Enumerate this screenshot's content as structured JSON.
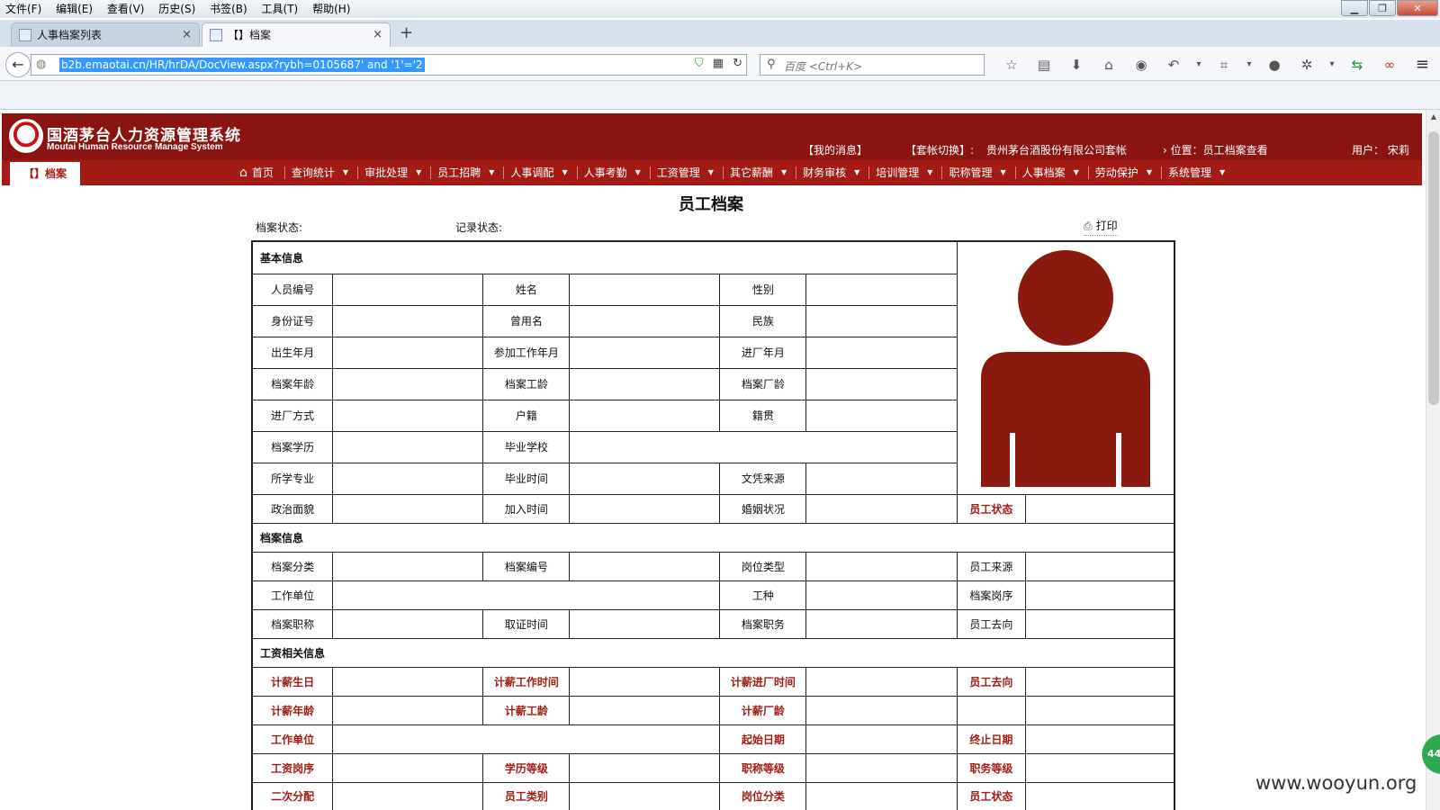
{
  "browser": {
    "menu": [
      "文件(F)",
      "编辑(E)",
      "查看(V)",
      "历史(S)",
      "书签(B)",
      "工具(T)",
      "帮助(H)"
    ],
    "window_controls": {
      "minimize": "▁",
      "restore": "❐",
      "close": "✕"
    },
    "tabs": [
      {
        "label": "人事档案列表",
        "close": "×"
      },
      {
        "label": "【】档案",
        "close": "×"
      }
    ],
    "new_tab": "+",
    "back": "←",
    "url": "b2b.emaotai.cn/HR/hrDA/DocView.aspx?rybh=0105687' and '1'='2",
    "url_icons": {
      "shield": "⛉",
      "qr": "▦",
      "reload": "↻"
    },
    "search_placeholder": "百度 <Ctrl+K>",
    "toolbar_icons": [
      {
        "name": "bookmark-star-icon",
        "glyph": "☆"
      },
      {
        "name": "reading-list-icon",
        "glyph": "▤"
      },
      {
        "name": "download-icon",
        "glyph": "⬇"
      },
      {
        "name": "home-icon",
        "glyph": "⌂"
      },
      {
        "name": "chat-icon",
        "glyph": "◉"
      },
      {
        "name": "undo-icon",
        "glyph": "↶"
      },
      {
        "name": "dropdown-icon",
        "glyph": "▾"
      },
      {
        "name": "crop-icon",
        "glyph": "⌗"
      },
      {
        "name": "dropdown-icon",
        "glyph": "▾"
      },
      {
        "name": "message-icon",
        "glyph": "●"
      },
      {
        "name": "bug-icon",
        "glyph": "✲"
      },
      {
        "name": "dropdown-icon",
        "glyph": "▾"
      },
      {
        "name": "sync-icon",
        "glyph": "⇆"
      },
      {
        "name": "link-icon",
        "glyph": "∞"
      }
    ],
    "menu_icon": "≡"
  },
  "app": {
    "logo_title": "国酒茅台人力资源管理系统",
    "logo_subtitle": "Moutai Human Resource Manage System",
    "my_messages": "【我的消息】",
    "account_switch": "【套帐切换】:",
    "account_value": "贵州茅台酒股份有限公司套帐",
    "location": "› 位置：员工档案查看",
    "user": "用户：  宋莉",
    "active_tab": "【】档案",
    "nav": [
      "首页",
      "查询统计",
      "审批处理",
      "员工招聘",
      "人事调配",
      "人事考勤",
      "工资管理",
      "其它薪酬",
      "财务审核",
      "培训管理",
      "职称管理",
      "人事档案",
      "劳动保护",
      "系统管理"
    ],
    "nav_caret": "▼",
    "home_glyph": "⌂",
    "page_title": "员工档案",
    "doc_status_label": "档案状态:",
    "record_status_label": "记录状态:",
    "print_label": "打印",
    "print_glyph": "⎙"
  },
  "table": {
    "section_basic": "基本信息",
    "section_archive": "档案信息",
    "section_salary": "工资相关信息",
    "basic_rows": [
      [
        "人员编号",
        "姓名",
        "性别"
      ],
      [
        "身份证号",
        "曾用名",
        "民族"
      ],
      [
        "出生年月",
        "参加工作年月",
        "进厂年月"
      ],
      [
        "档案年龄",
        "档案工龄",
        "档案厂龄"
      ],
      [
        "进厂方式",
        "户籍",
        "籍贯"
      ]
    ],
    "edu_row": [
      "档案学历",
      "毕业学校"
    ],
    "major_row": [
      "所学专业",
      "毕业时间",
      "文凭来源"
    ],
    "politics_row": [
      "政治面貌",
      "加入时间",
      "婚姻状况",
      "员工状态"
    ],
    "archive_row1": [
      "档案分类",
      "档案编号",
      "岗位类型",
      "员工来源"
    ],
    "archive_row2": [
      "工作单位",
      "工种",
      "档案岗序"
    ],
    "archive_row3": [
      "档案职称",
      "取证时间",
      "档案职务",
      "员工去向"
    ],
    "salary_row1": [
      "计薪生日",
      "计薪工作时间",
      "计薪进厂时间",
      "员工去向"
    ],
    "salary_row2": [
      "计薪年龄",
      "计薪工龄",
      "计薪厂龄"
    ],
    "salary_row3": [
      "工作单位",
      "起始日期",
      "终止日期"
    ],
    "salary_row4": [
      "工资岗序",
      "学历等级",
      "职称等级",
      "职务等级"
    ],
    "salary_row5": [
      "二次分配",
      "员工类别",
      "岗位分类",
      "员工状态"
    ]
  },
  "colors": {
    "brand_dark": "#8b1410",
    "brand": "#a31b14",
    "avatar": "#8b1a0e"
  },
  "side_badge": "44",
  "watermark": "www.wooyun.org"
}
